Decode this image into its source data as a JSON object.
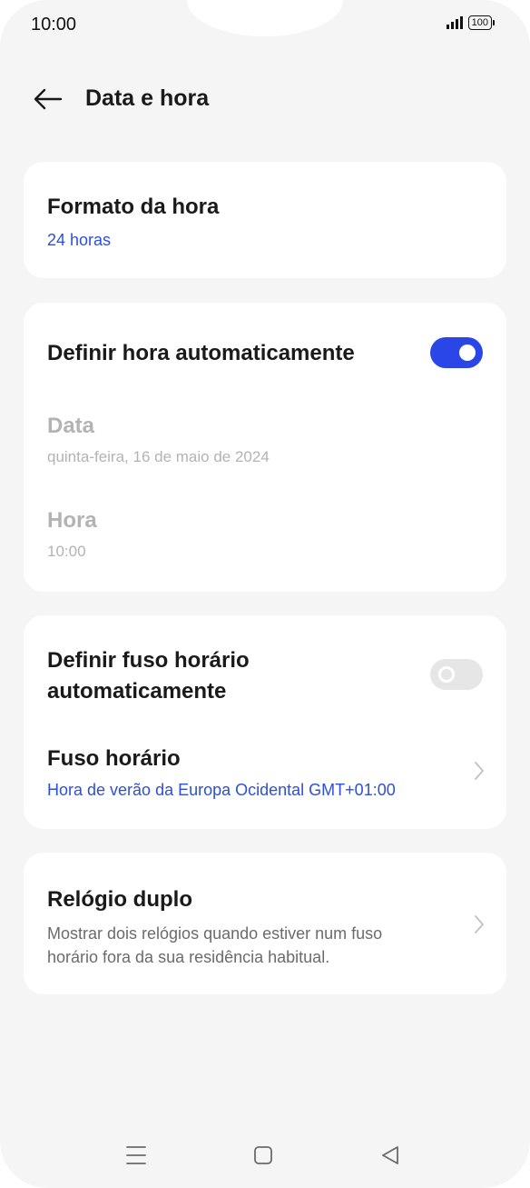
{
  "status_bar": {
    "time": "10:00",
    "battery": "100"
  },
  "header": {
    "title": "Data e hora"
  },
  "time_format": {
    "title": "Formato da hora",
    "value": "24 horas"
  },
  "auto_time": {
    "title": "Definir hora automaticamente",
    "toggle_on": true,
    "date_title": "Data",
    "date_value": "quinta-feira, 16 de maio de 2024",
    "time_title": "Hora",
    "time_value": "10:00"
  },
  "auto_timezone": {
    "title_line1": "Definir fuso horário",
    "title_line2": "automaticamente",
    "toggle_on": false,
    "timezone_title": "Fuso horário",
    "timezone_value": "Hora de verão da Europa Ocidental GMT+01:00"
  },
  "dual_clock": {
    "title": "Relógio duplo",
    "desc_line1": "Mostrar dois relógios quando estiver num fuso",
    "desc_line2": "horário fora da sua residência habitual."
  },
  "colors": {
    "accent": "#2b46e6",
    "link": "#2e4fd6",
    "background": "#f5f5f5"
  },
  "nav_icons": [
    "menu-icon",
    "home-icon",
    "back-triangle-icon"
  ]
}
